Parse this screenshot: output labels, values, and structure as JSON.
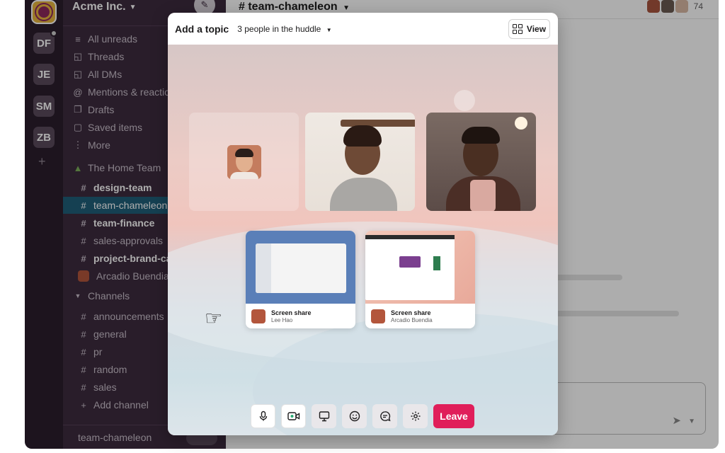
{
  "workspace": {
    "name": "Acme Inc.",
    "others": [
      "DF",
      "JE",
      "SM",
      "ZB"
    ],
    "add_symbol": "+"
  },
  "sidebar": {
    "nav": [
      {
        "label": "All unreads",
        "icon": "unreads-icon"
      },
      {
        "label": "Threads",
        "icon": "threads-icon"
      },
      {
        "label": "All DMs",
        "icon": "dms-icon"
      },
      {
        "label": "Mentions & reactions",
        "icon": "mentions-icon"
      },
      {
        "label": "Drafts",
        "icon": "drafts-icon"
      },
      {
        "label": "Saved items",
        "icon": "bookmark-icon"
      },
      {
        "label": "More",
        "icon": "more-icon"
      }
    ],
    "section_team": "The Home Team",
    "team_channels": [
      {
        "label": "design-team",
        "bold": true
      },
      {
        "label": "team-chameleon",
        "active": true
      },
      {
        "label": "team-finance",
        "bold": true
      },
      {
        "label": "sales-approvals"
      },
      {
        "label": "project-brand-campaign",
        "bold": true
      }
    ],
    "dm": "Arcadio Buendia",
    "section_channels": "Channels",
    "channels": [
      "announcements",
      "general",
      "pr",
      "random",
      "sales"
    ],
    "add_channel": "Add channel",
    "footer": "team-chameleon"
  },
  "channel": {
    "title": "# team-chameleon",
    "member_count": "74"
  },
  "huddle": {
    "topic": "Add a topic",
    "people": "3 people in the huddle",
    "view_label": "View",
    "shares": [
      {
        "title": "Screen share",
        "name": "Lee Hao"
      },
      {
        "title": "Screen share",
        "name": "Arcadio Buendia"
      }
    ],
    "leave_label": "Leave"
  },
  "colors": {
    "sidebar": "#3d2b3f",
    "active_channel": "#1f5f7a",
    "leave": "#e01e5a"
  }
}
